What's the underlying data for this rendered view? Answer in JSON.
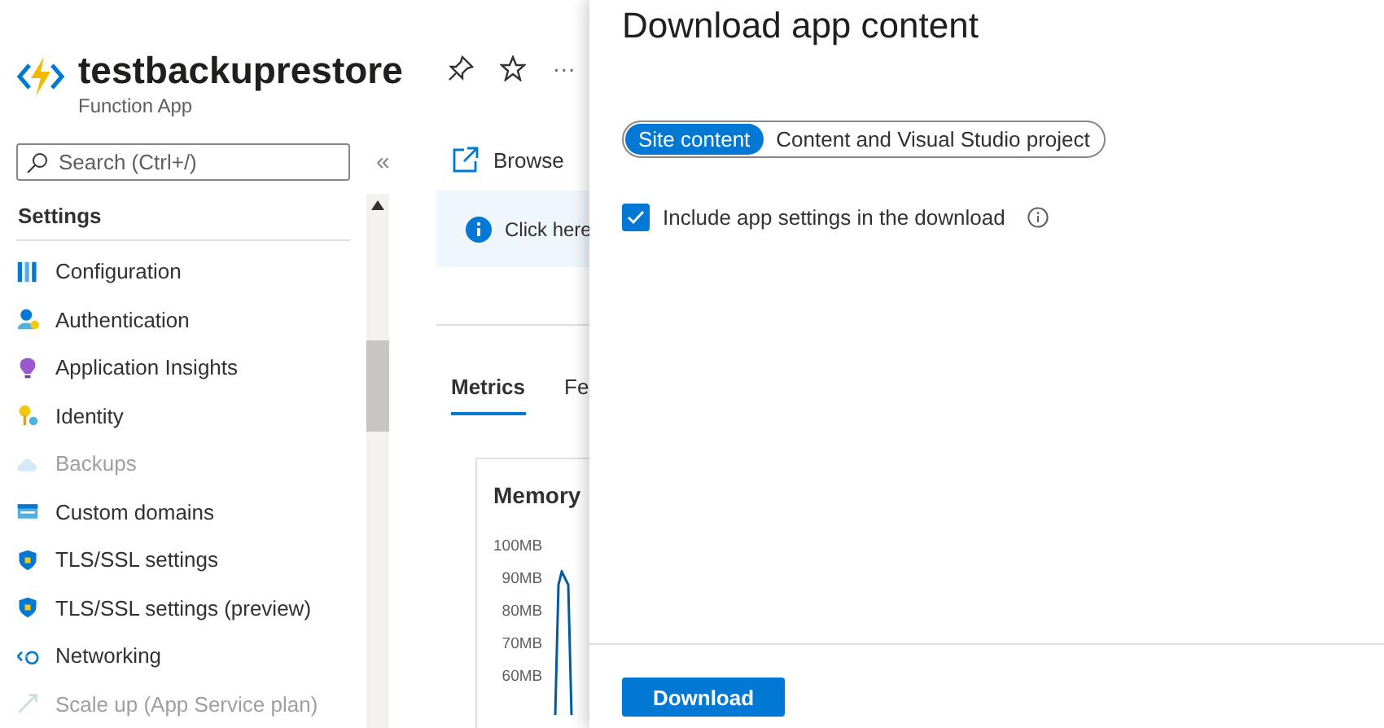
{
  "header": {
    "title": "testbackuprestore",
    "subtitle": "Function App",
    "more": "···"
  },
  "search": {
    "placeholder": "Search (Ctrl+/)"
  },
  "collapse": "«",
  "sidebar": {
    "section": "Settings",
    "items": [
      {
        "label": "Configuration",
        "disabled": false
      },
      {
        "label": "Authentication",
        "disabled": false
      },
      {
        "label": "Application Insights",
        "disabled": false
      },
      {
        "label": "Identity",
        "disabled": false
      },
      {
        "label": "Backups",
        "disabled": true
      },
      {
        "label": "Custom domains",
        "disabled": false
      },
      {
        "label": "TLS/SSL settings",
        "disabled": false
      },
      {
        "label": "TLS/SSL settings (preview)",
        "disabled": false
      },
      {
        "label": "Networking",
        "disabled": false
      },
      {
        "label": "Scale up (App Service plan)",
        "disabled": true
      }
    ]
  },
  "toolbar": {
    "browse": "Browse"
  },
  "banner": {
    "text": "Click here"
  },
  "tabs": [
    {
      "label": "Metrics",
      "selected": true
    },
    {
      "label": "Fe",
      "selected": false
    }
  ],
  "memory_chart": {
    "title": "Memory",
    "y_labels": [
      "100MB",
      "90MB",
      "80MB",
      "70MB",
      "60MB"
    ]
  },
  "panel": {
    "title": "Download app content",
    "options": [
      {
        "label": "Site content",
        "selected": true
      },
      {
        "label": "Content and Visual Studio project",
        "selected": false
      }
    ],
    "include_settings": {
      "label": "Include app settings in the download",
      "checked": true
    },
    "button": "Download"
  }
}
